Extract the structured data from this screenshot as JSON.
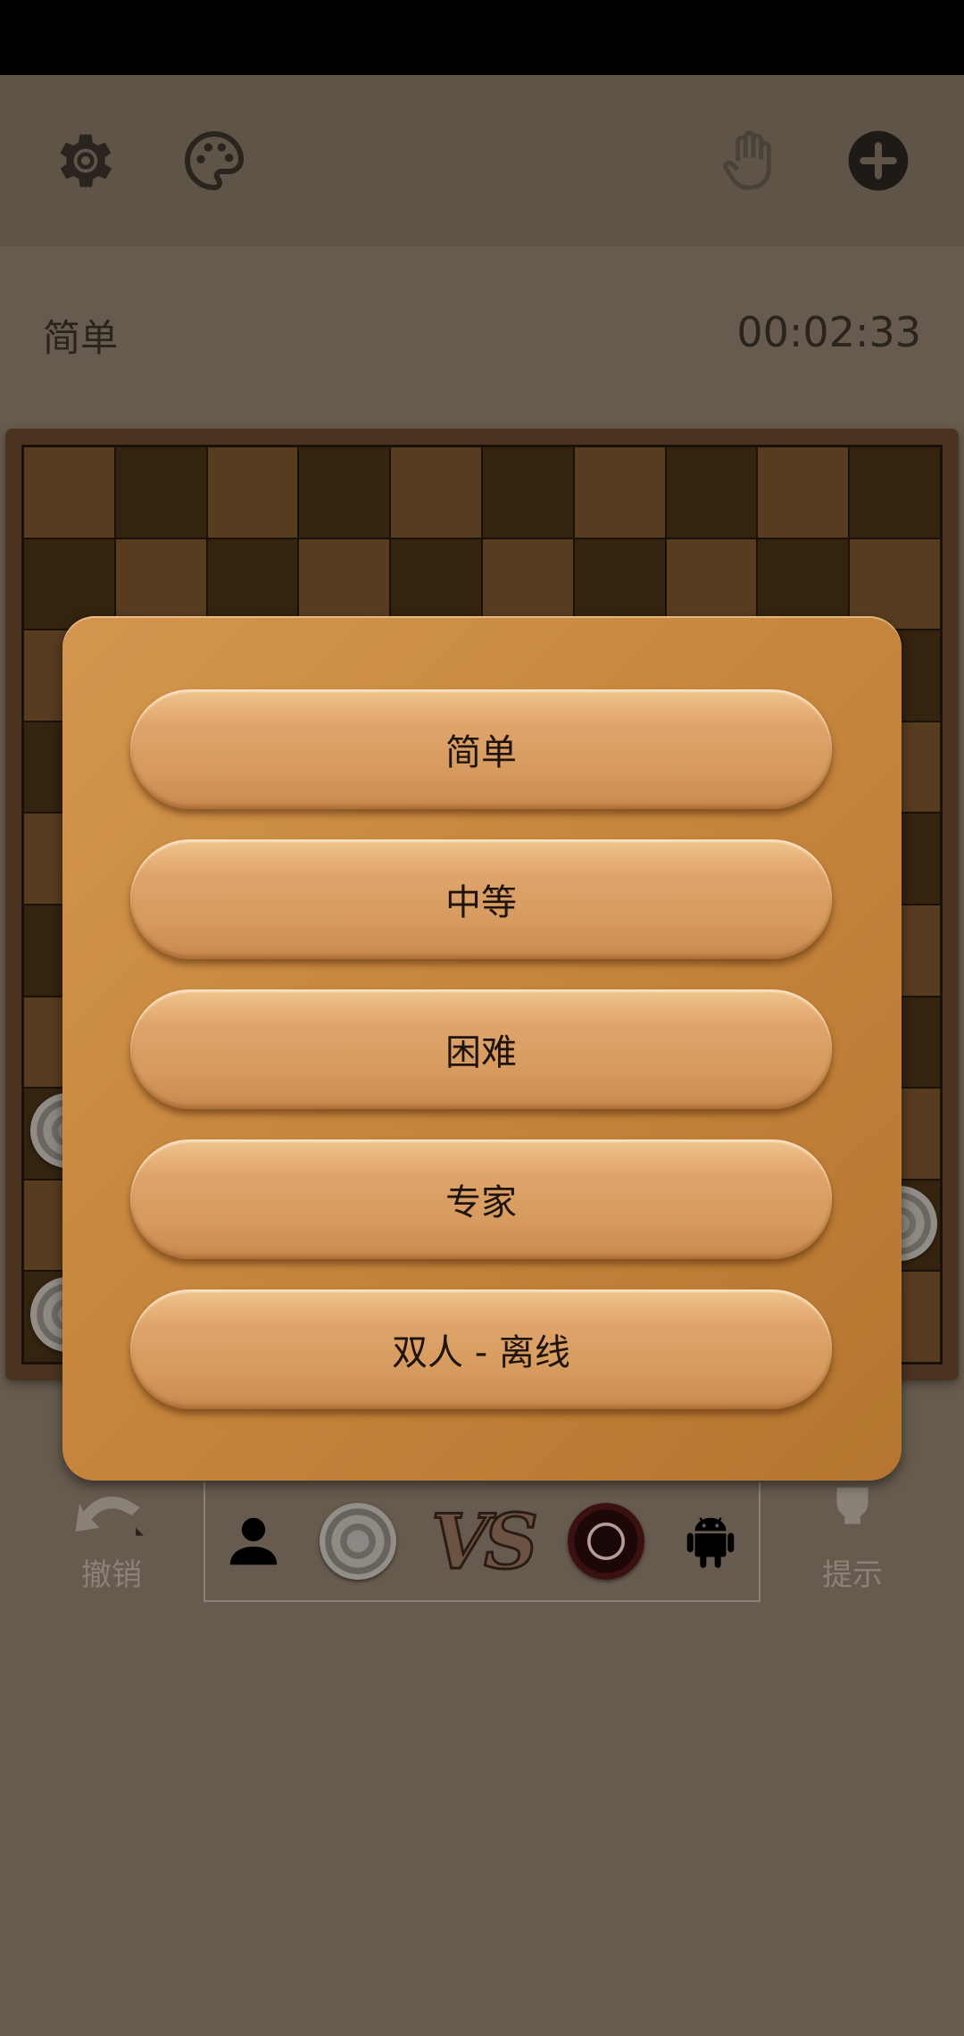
{
  "toolbar": {
    "settings_icon": "gear-icon",
    "theme_icon": "palette-icon",
    "draw_icon": "hand-icon",
    "new_game_icon": "plus-circle-icon"
  },
  "game": {
    "level": "简单",
    "timer": "00:02:33"
  },
  "bottom": {
    "undo_label": "撤销",
    "hint_label": "提示",
    "vs_text": "VS"
  },
  "dialog": {
    "options": [
      "简单",
      "中等",
      "困难",
      "专家",
      "双人 - 离线"
    ]
  }
}
